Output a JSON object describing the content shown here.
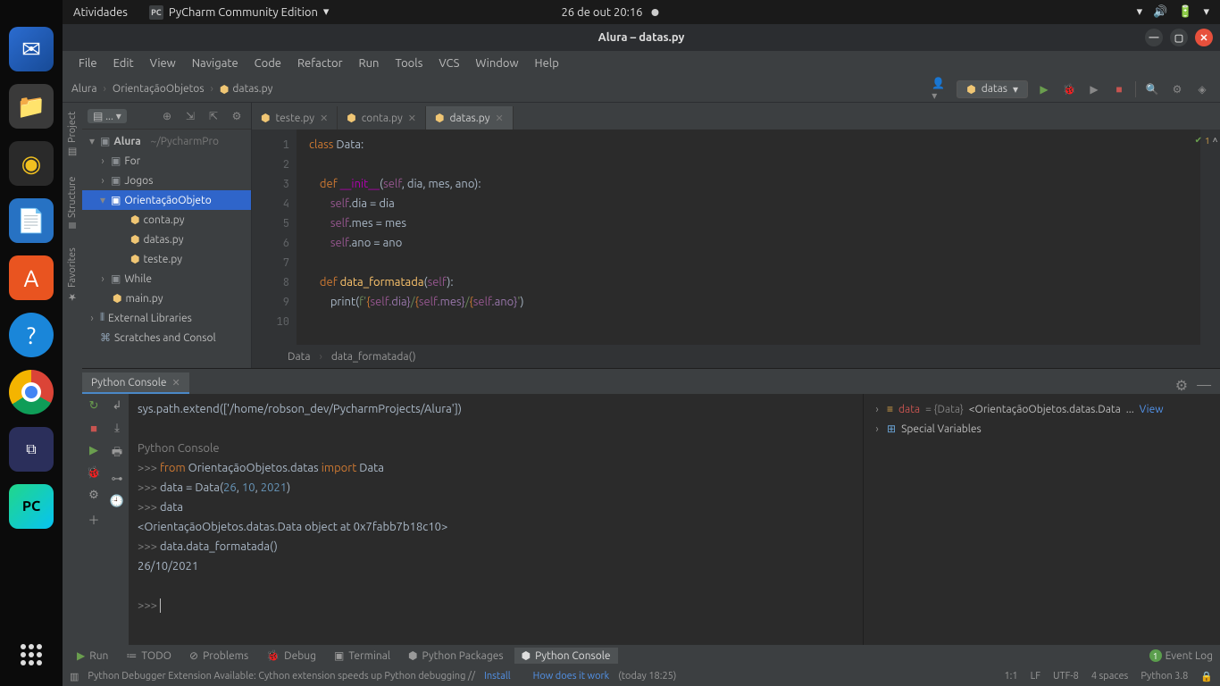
{
  "gnome": {
    "activities": "Atividades",
    "app": "PyCharm Community Edition",
    "clock": "26 de out  20:16"
  },
  "window": {
    "title": "Alura – datas.py"
  },
  "menus": [
    "File",
    "Edit",
    "View",
    "Navigate",
    "Code",
    "Refactor",
    "Run",
    "Tools",
    "VCS",
    "Window",
    "Help"
  ],
  "breadcrumb": {
    "a": "Alura",
    "b": "OrientaçãoObjetos",
    "c": "datas.py"
  },
  "run_config": "datas",
  "project": {
    "selector": "...",
    "root": "Alura",
    "root_sub": "~/PycharmPro",
    "for": "For",
    "jogos": "Jogos",
    "oo": "OrientaçãoObjeto",
    "conta": "conta.py",
    "datas": "datas.py",
    "teste": "teste.py",
    "while": "While",
    "main": "main.py",
    "ext": "External Libraries",
    "scratch": "Scratches and Consol"
  },
  "tabs": {
    "t1": "teste.py",
    "t2": "conta.py",
    "t3": "datas.py"
  },
  "code": {
    "l1a": "class",
    "l1b": " Data:",
    "l3a": "def ",
    "l3b": "__init__",
    "l3c": "(",
    "l3d": "self",
    "l3e": ", dia, mes, ano):",
    "l4a": "self",
    "l4b": ".dia = dia",
    "l5a": "self",
    "l5b": ".mes = mes",
    "l6a": "self",
    "l6b": ".ano = ano",
    "l8a": "def ",
    "l8b": "data_formatada",
    "l8c": "(",
    "l8d": "self",
    "l8e": "):",
    "l9a": "print(",
    "l9b": "f'",
    "l9c": "{",
    "l9d": "self",
    "l9e": ".dia}",
    "l9f": "/",
    "l9g": "{",
    "l9h": "self",
    "l9i": ".mes}",
    "l9j": "/",
    "l9k": "{",
    "l9l": "self",
    "l9m": ".ano}",
    "l9n": "'",
    "l9o": ")"
  },
  "bc2": {
    "a": "Data",
    "b": "data_formatada()"
  },
  "insp": "1",
  "console": {
    "tab": "Python Console",
    "l0": "sys.path.extend(['/home/robson_dev/PycharmProjects/Alura'])",
    "title": "Python Console",
    "p": ">>> ",
    "i1a": "from ",
    "i1b": "OrientaçãoObjetos.datas ",
    "i1c": "import ",
    "i1d": "Data",
    "i2a": "data = Data(",
    "i2b": "26",
    "i2c": ", ",
    "i2d": "10",
    "i2e": ", ",
    "i2f": "2021",
    "i2g": ")",
    "i3": "data",
    "o1": "<OrientaçãoObjetos.datas.Data object at 0x7fabb7b18c10>",
    "i4": "data.data_formatada()",
    "o2": "26/10/2021"
  },
  "vars": {
    "data_k": "data",
    "data_t": " = {Data} ",
    "data_v": "<OrientaçãoObjetos.datas.Data ",
    "data_view": "View",
    "sv": "Special Variables"
  },
  "btm": {
    "run": "Run",
    "todo": "TODO",
    "problems": "Problems",
    "debug": "Debug",
    "terminal": "Terminal",
    "pkg": "Python Packages",
    "pyc": "Python Console",
    "ev": "Event Log"
  },
  "status": {
    "msg": "Python Debugger Extension Available: Cython extension speeds up Python debugging // ",
    "install": "Install",
    "how": "How does it work",
    "when": " (today 18:25)",
    "pos": "1:1",
    "lf": "LF",
    "enc": "UTF-8",
    "ind": "4 spaces",
    "py": "Python 3.8"
  },
  "side": {
    "project": "Project",
    "structure": "Structure",
    "fav": "Favorites"
  }
}
